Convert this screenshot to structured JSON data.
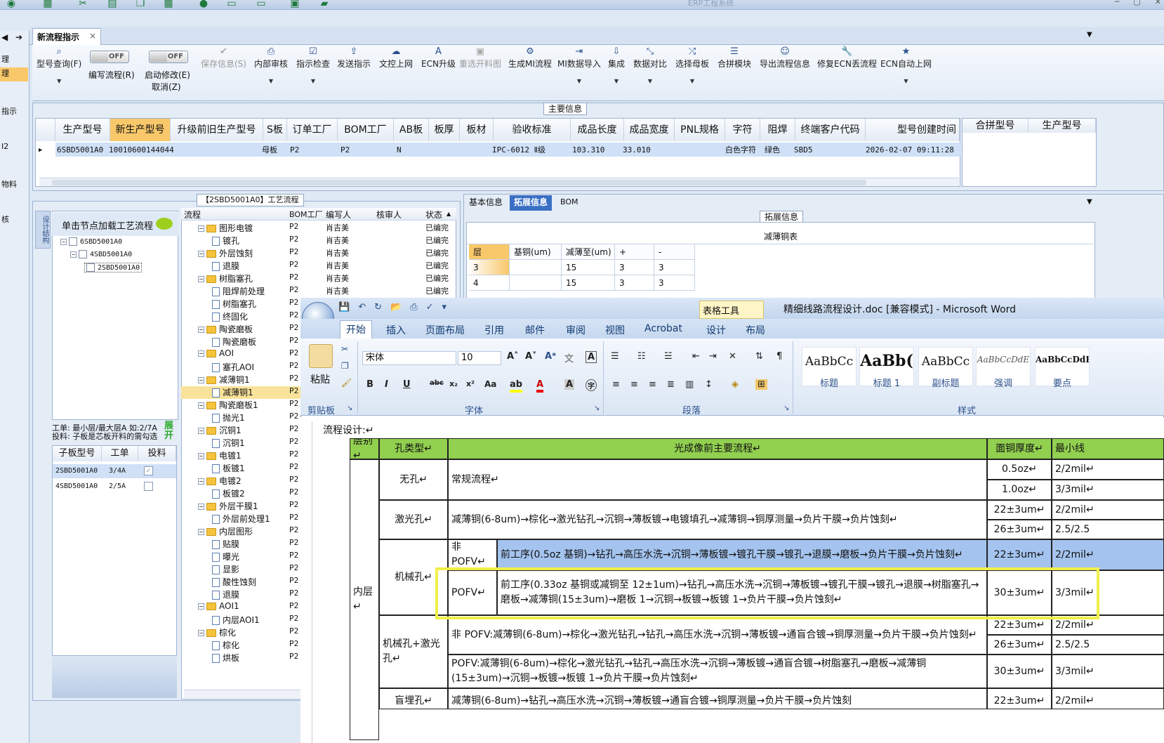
{
  "app": {
    "title": "ERP工程系统"
  },
  "left_strip": {
    "items": [
      "理",
      "理",
      "指示",
      "I2",
      "物料",
      "核"
    ]
  },
  "tab": {
    "label": "新流程指示",
    "close": "×"
  },
  "ribbon": {
    "buttons": [
      {
        "label": "型号查询(F)",
        "icon": "search-icon"
      },
      {
        "label": "保存信息(S)",
        "icon": "save-check-icon"
      },
      {
        "label": "内部审核",
        "icon": "printer-icon"
      },
      {
        "label": "指示检查",
        "icon": "checklist-icon"
      },
      {
        "label": "发送指示",
        "icon": "upload-icon"
      },
      {
        "label": "文控上网",
        "icon": "cloud-upload-icon"
      },
      {
        "label": "ECN升级",
        "icon": "a-icon"
      },
      {
        "label": "重选开料图",
        "icon": "image-icon"
      },
      {
        "label": "生成MI流程",
        "icon": "gears-icon"
      },
      {
        "label": "MI数据导入",
        "icon": "import-icon"
      },
      {
        "label": "集成",
        "icon": "download-icon"
      },
      {
        "label": "数据对比",
        "icon": "compare-icon"
      },
      {
        "label": "选择母板",
        "icon": "shuffle-icon"
      },
      {
        "label": "合拼模块",
        "icon": "list-icon"
      },
      {
        "label": "导出流程信息",
        "icon": "smile-icon"
      },
      {
        "label": "修复ECN丢流程",
        "icon": "wrench-icon"
      },
      {
        "label": "ECN自动上网",
        "icon": "star-icon"
      }
    ],
    "toggles": [
      {
        "state": "OFF",
        "label": "编写流程(R)"
      },
      {
        "state": "OFF",
        "label": "启动修改(E)",
        "label2": "取消(Z)"
      }
    ]
  },
  "main_info": {
    "caption": "主要信息",
    "columns": [
      "生产型号",
      "新生产型号",
      "升级前旧生产型号",
      "S板",
      "订单工厂",
      "BOM工厂",
      "AB板",
      "板厚",
      "板材",
      "验收标准",
      "成品长度",
      "成品宽度",
      "PNL规格",
      "字符",
      "阻焊",
      "终端客户代码",
      "型号创建时间"
    ],
    "row": [
      "6SBD5001A0",
      "10010600144044",
      "",
      "母板",
      "P2",
      "P2",
      "N",
      "",
      "",
      "IPC-6012 Ⅱ级",
      "103.310",
      "33.010",
      "",
      "白色字符",
      "绿色",
      "SBD5",
      "2026-02-07 09:11:28"
    ]
  },
  "merge_grid": {
    "columns": [
      "合拼型号",
      "生产型号"
    ]
  },
  "process": {
    "caption": "【2SBD5001A0】工艺流程",
    "vtab": "设计结构",
    "node_header": "单击节点加载工艺流程",
    "nodes": [
      "6SBD5001A0",
      "4SBD5001A0",
      "2SBD5001A0"
    ],
    "work_info_1": "工单: 最小层/最大层A 如:2/7A",
    "work_info_2": "投料: 子板是芯板开料的需勾选",
    "expand": "展开",
    "sub_columns": [
      "子板型号",
      "工单",
      "投料"
    ],
    "sub_rows": [
      {
        "model": "2SBD5001A0",
        "order": "3/4A",
        "check": "✓"
      },
      {
        "model": "4SBD5001A0",
        "order": "2/5A",
        "check": ""
      }
    ]
  },
  "flow_tree": {
    "columns": [
      "流程",
      "BOM工厂",
      "编写人",
      "核审人",
      "状态"
    ],
    "rows": [
      {
        "name": "图形电镀",
        "folder": true,
        "bom": "P2",
        "author": "肖吉美",
        "status": "已编完"
      },
      {
        "name": "镀孔",
        "folder": false,
        "bom": "P2",
        "author": "肖吉美",
        "status": "已编完"
      },
      {
        "name": "外层蚀刻",
        "folder": true,
        "bom": "P2",
        "author": "肖吉美",
        "status": "已编完"
      },
      {
        "name": "退膜",
        "folder": false,
        "bom": "P2",
        "author": "肖吉美",
        "status": "已编完"
      },
      {
        "name": "树脂塞孔",
        "folder": true,
        "bom": "P2",
        "author": "肖吉美",
        "status": "已编完"
      },
      {
        "name": "阻焊前处理",
        "folder": false,
        "bom": "P2",
        "author": "肖吉美",
        "status": "已编完"
      },
      {
        "name": "树脂塞孔",
        "folder": false,
        "bom": "P2",
        "author": "",
        "status": ""
      },
      {
        "name": "终固化",
        "folder": false,
        "bom": "P2",
        "author": "",
        "status": ""
      },
      {
        "name": "陶瓷磨板",
        "folder": true,
        "bom": "P2",
        "author": "",
        "status": ""
      },
      {
        "name": "陶瓷磨板",
        "folder": false,
        "bom": "P2",
        "author": "",
        "status": ""
      },
      {
        "name": "AOI",
        "folder": true,
        "bom": "P2",
        "author": "",
        "status": ""
      },
      {
        "name": "塞孔AOI",
        "folder": false,
        "bom": "P2",
        "author": "",
        "status": ""
      },
      {
        "name": "减薄铜1",
        "folder": true,
        "bom": "P2",
        "author": "",
        "status": ""
      },
      {
        "name": "减薄铜1",
        "folder": false,
        "bom": "P2",
        "author": "",
        "status": "",
        "selected": true
      },
      {
        "name": "陶瓷磨板1",
        "folder": true,
        "bom": "P2",
        "author": "",
        "status": ""
      },
      {
        "name": "抛光1",
        "folder": false,
        "bom": "P2",
        "author": "",
        "status": ""
      },
      {
        "name": "沉铜1",
        "folder": true,
        "bom": "P2",
        "author": "",
        "status": ""
      },
      {
        "name": "沉铜1",
        "folder": false,
        "bom": "P2",
        "author": "",
        "status": ""
      },
      {
        "name": "电镀1",
        "folder": true,
        "bom": "P2",
        "author": "",
        "status": ""
      },
      {
        "name": "板镀1",
        "folder": false,
        "bom": "P2",
        "author": "",
        "status": ""
      },
      {
        "name": "电镀2",
        "folder": true,
        "bom": "P2",
        "author": "",
        "status": ""
      },
      {
        "name": "板镀2",
        "folder": false,
        "bom": "P2",
        "author": "",
        "status": ""
      },
      {
        "name": "外层干膜1",
        "folder": true,
        "bom": "P2",
        "author": "",
        "status": ""
      },
      {
        "name": "外层前处理1",
        "folder": false,
        "bom": "P2",
        "author": "",
        "status": ""
      },
      {
        "name": "内层图形",
        "folder": true,
        "bom": "P2",
        "author": "",
        "status": ""
      },
      {
        "name": "贴膜",
        "folder": false,
        "bom": "P2",
        "author": "",
        "status": ""
      },
      {
        "name": "曝光",
        "folder": false,
        "bom": "P2",
        "author": "",
        "status": ""
      },
      {
        "name": "显影",
        "folder": false,
        "bom": "P2",
        "author": "",
        "status": ""
      },
      {
        "name": "酸性蚀刻",
        "folder": false,
        "bom": "P2",
        "author": "",
        "status": ""
      },
      {
        "name": "退膜",
        "folder": false,
        "bom": "P2",
        "author": "",
        "status": ""
      },
      {
        "name": "AOI1",
        "folder": true,
        "bom": "P2",
        "author": "",
        "status": ""
      },
      {
        "name": "内层AOI1",
        "folder": false,
        "bom": "P2",
        "author": "",
        "status": ""
      },
      {
        "name": "棕化",
        "folder": true,
        "bom": "P2",
        "author": "",
        "status": ""
      },
      {
        "name": "棕化",
        "folder": false,
        "bom": "P2",
        "author": "",
        "status": ""
      },
      {
        "name": "烘板",
        "folder": false,
        "bom": "P2",
        "author": "",
        "status": ""
      }
    ]
  },
  "ext": {
    "tabs": [
      "基本信息",
      "拓展信息",
      "BOM"
    ],
    "caption": "拓展信息",
    "table_title": "减薄铜表",
    "columns": [
      "层",
      "基铜(um)",
      "减薄至(um)",
      "+",
      "-"
    ],
    "rows": [
      [
        "3",
        "",
        "15",
        "3",
        "3"
      ],
      [
        "4",
        "",
        "15",
        "3",
        "3"
      ]
    ]
  },
  "word": {
    "title": "精细线路流程设计.doc [兼容模式] - Microsoft Word",
    "table_tools": "表格工具",
    "tabs": [
      "开始",
      "插入",
      "页面布局",
      "引用",
      "邮件",
      "审阅",
      "视图",
      "Acrobat",
      "设计",
      "布局"
    ],
    "font_name": "宋体",
    "font_size": "10",
    "groups": [
      "剪贴板",
      "字体",
      "段落",
      "样式"
    ],
    "paste": "粘贴",
    "styles": [
      {
        "preview": "AaBbCc",
        "label": "标题"
      },
      {
        "preview": "AaBb(",
        "label": "标题 1"
      },
      {
        "preview": "AaBbCc",
        "label": "副标题"
      },
      {
        "preview": "AaBbCcDdE",
        "label": "强调"
      },
      {
        "preview": "AaBbCcDdE",
        "label": "要点"
      }
    ]
  },
  "doc": {
    "subtitle": "流程设计:↵",
    "headers": [
      "层别↵",
      "孔类型↵",
      "光成像前主要流程↵",
      "面铜厚度↵",
      "最小线"
    ],
    "layer": "内层↵",
    "row_none": {
      "type": "无孔↵",
      "flow": "常规流程↵",
      "cu": [
        "0.5oz↵",
        "1.0oz↵"
      ],
      "min": [
        "2/2mil↵",
        "3/3mil↵"
      ]
    },
    "row_laser": {
      "type": "激光孔↵",
      "flow": "减薄铜(6-8um)→棕化→激光钻孔→沉铜→薄板镀→电镀填孔→减薄铜→铜厚测量→负片干膜→负片蚀刻↵",
      "cu": [
        "22±3um↵",
        "26±3um↵"
      ],
      "min": [
        "2/2mil↵",
        "2.5/2.5"
      ]
    },
    "row_mech": {
      "type": "机械孔↵",
      "sub1": "非 POFV↵",
      "flow1": "前工序(0.5oz 基铜)→钻孔→高压水洗→沉铜→薄板镀→镀孔干膜→镀孔→退膜→磨板→负片干膜→负片蚀刻↵",
      "cu1": "22±3um↵",
      "min1": "2/2mil↵",
      "sub2": "POFV↵",
      "flow2": "前工序(0.33oz 基铜或减铜至 12±1um)→钻孔→高压水洗→沉铜→薄板镀→镀孔干膜→镀孔→退膜→树脂塞孔→磨板→减薄铜(15±3um)→磨板 1→沉铜→板镀→板镀 1→负片干膜→负片蚀刻↵",
      "cu2": "30±3um↵",
      "min2": "3/3mil↵"
    },
    "row_combo": {
      "type": "机械孔+激光孔↵",
      "flow1": "非 POFV:减薄铜(6-8um)→棕化→激光钻孔→钻孔→高压水洗→沉铜→薄板镀→通盲合镀→铜厚测量→负片干膜→负片蚀刻↵",
      "cu1": [
        "22±3um↵",
        "26±3um↵"
      ],
      "min1": [
        "2/2mil↵",
        "2.5/2.5"
      ],
      "flow2": "POFV:减薄铜(6-8um)→棕化→激光钻孔→钻孔→高压水洗→沉铜→薄板镀→通盲合镀→树脂塞孔→磨板→减薄铜(15±3um)→沉铜→板镀→板镀 1→负片干膜→负片蚀刻↵",
      "cu2": "30±3um↵",
      "min2": "3/3mil↵"
    },
    "row_last": {
      "type": "盲埋孔↵",
      "flow": "减薄铜(6-8um)→钻孔→高压水洗→沉铜→薄板镀→通盲合镀→铜厚测量→负片干膜→负片蚀刻",
      "cu": "22±3um↵",
      "min": "2/2mil↵"
    }
  }
}
